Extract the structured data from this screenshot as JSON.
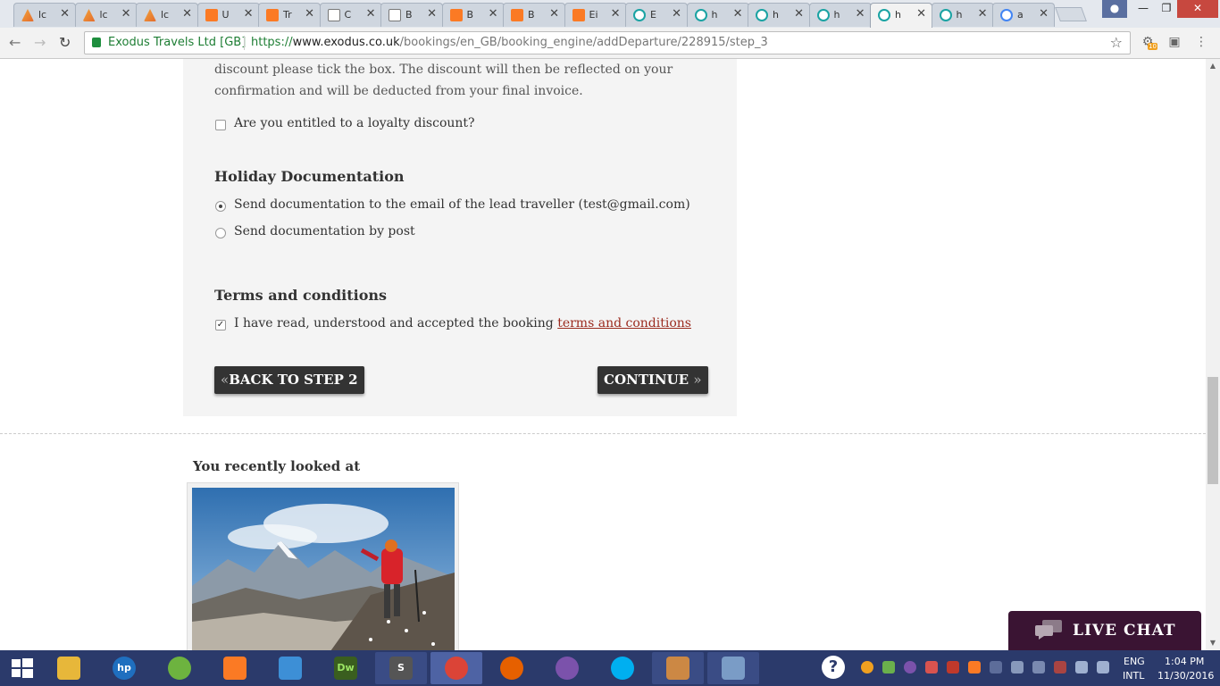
{
  "browser": {
    "tabs": [
      {
        "title": "lc",
        "icon": "pma"
      },
      {
        "title": "lc",
        "icon": "pma"
      },
      {
        "title": "lc",
        "icon": "pma"
      },
      {
        "title": "U",
        "icon": "xampp"
      },
      {
        "title": "Tr",
        "icon": "xampp"
      },
      {
        "title": "C",
        "icon": "doc"
      },
      {
        "title": "B",
        "icon": "doc"
      },
      {
        "title": "B",
        "icon": "xampp"
      },
      {
        "title": "B",
        "icon": "xampp"
      },
      {
        "title": "Ei",
        "icon": "xampp"
      },
      {
        "title": "E",
        "icon": "exo"
      },
      {
        "title": "h",
        "icon": "exo"
      },
      {
        "title": "h",
        "icon": "exo"
      },
      {
        "title": "h",
        "icon": "exo"
      },
      {
        "title": "h",
        "icon": "exo"
      },
      {
        "title": "h",
        "icon": "exo"
      },
      {
        "title": "a",
        "icon": "goog"
      }
    ],
    "close_glyph": "✕",
    "security_name": "Exodus Travels Ltd [GB]",
    "url_scheme": "https://",
    "url_host": "www.exodus.co.uk",
    "url_path": "/bookings/en_GB/booking_engine/addDeparture/228915/step_3",
    "ext_badge": "10"
  },
  "page": {
    "discount_text": "discount please tick the box. The discount will then be reflected on your confirmation and will be deducted from your final invoice.",
    "loyalty_label": "Are you entitled to a loyalty discount?",
    "loyalty_checked": false,
    "doc_heading": "Holiday Documentation",
    "doc_options": [
      {
        "label": "Send documentation to the email of the lead traveller (test@gmail.com)",
        "selected": true
      },
      {
        "label": "Send documentation by post",
        "selected": false
      }
    ],
    "terms_heading": "Terms and conditions",
    "terms_label": "I have read, understood and accepted the booking ",
    "terms_link": "terms and conditions",
    "terms_checked": true,
    "back_button": "BACK TO STEP 2",
    "continue_button": "CONTINUE",
    "recent_title": "You recently looked at",
    "live_chat": "LIVE CHAT"
  },
  "taskbar": {
    "apps": [
      "explorer",
      "hp",
      "spring",
      "xampp",
      "media",
      "Dw",
      "sublime",
      "chrome",
      "firefox",
      "viber",
      "skype",
      "winapp",
      "paint"
    ],
    "language_top": "ENG",
    "language_bottom": "INTL",
    "time": "1:04 PM",
    "date": "11/30/2016"
  },
  "colors": {
    "link": "#9b2b1f",
    "button_bg": "#333333",
    "live_chat_bg": "#3a1433",
    "taskbar_bg": "#2b3a6b",
    "secure_green": "#1e7e34"
  }
}
